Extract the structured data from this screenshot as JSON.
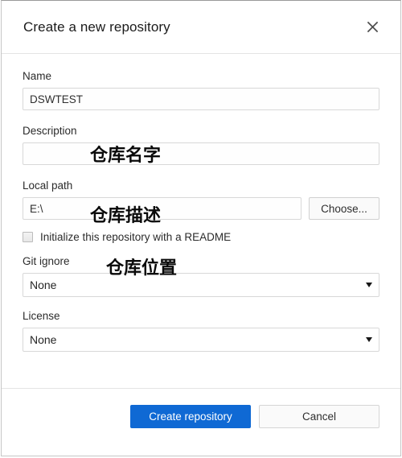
{
  "dialog": {
    "title": "Create a new repository",
    "close_icon": "close-icon"
  },
  "form": {
    "name": {
      "label": "Name",
      "value": "DSWTEST",
      "placeholder": "",
      "annotation": "仓库名字"
    },
    "description": {
      "label": "Description",
      "value": "",
      "placeholder": "",
      "annotation": "仓库描述"
    },
    "local_path": {
      "label": "Local path",
      "value": "E:\\",
      "placeholder": "",
      "annotation": "仓库位置",
      "choose_label": "Choose..."
    },
    "readme": {
      "label": "Initialize this repository with a README",
      "checked": false
    },
    "gitignore": {
      "label": "Git ignore",
      "value": "None",
      "options": [
        "None"
      ]
    },
    "license": {
      "label": "License",
      "value": "None",
      "options": [
        "None"
      ]
    }
  },
  "footer": {
    "create_label": "Create repository",
    "cancel_label": "Cancel"
  },
  "colors": {
    "primary": "#0f69d4",
    "border": "#d8d8d8",
    "text": "#2b2b2b",
    "annotation": "#0a0a0a"
  }
}
